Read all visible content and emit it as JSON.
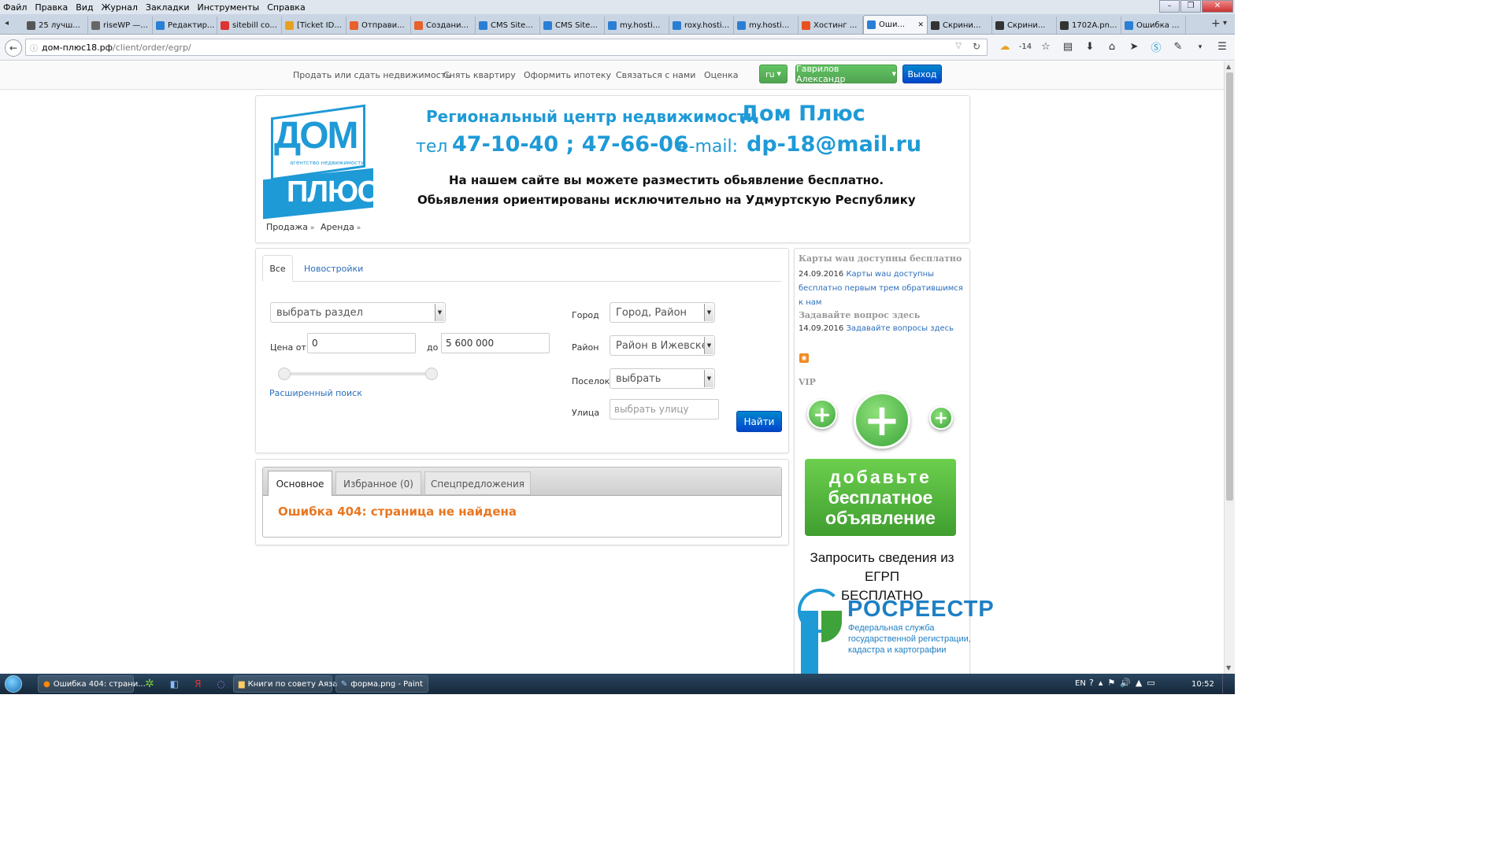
{
  "browser": {
    "menu": [
      "Файл",
      "Правка",
      "Вид",
      "Журнал",
      "Закладки",
      "Инструменты",
      "Справка"
    ],
    "tabs": [
      {
        "label": "25 лучш...",
        "color": "#555"
      },
      {
        "label": "riseWP —...",
        "color": "#666"
      },
      {
        "label": "Редактир...",
        "color": "#2a7fd4"
      },
      {
        "label": "sitebill co...",
        "color": "#d33"
      },
      {
        "label": "[Ticket ID...",
        "color": "#e8a020"
      },
      {
        "label": "Отправи...",
        "color": "#e8602c"
      },
      {
        "label": "Создани...",
        "color": "#e8602c"
      },
      {
        "label": "CMS Site...",
        "color": "#2a7fd4"
      },
      {
        "label": "CMS Site...",
        "color": "#2a7fd4"
      },
      {
        "label": "my.hosti...",
        "color": "#2a7fd4"
      },
      {
        "label": "roxy.hosti...",
        "color": "#2a7fd4"
      },
      {
        "label": "my.hosti...",
        "color": "#2a7fd4"
      },
      {
        "label": "Хостинг ...",
        "color": "#e85020"
      },
      {
        "label": "Оши...",
        "color": "#2a7fd4",
        "active": true
      },
      {
        "label": "Скрини...",
        "color": "#333"
      },
      {
        "label": "Скрини...",
        "color": "#333"
      },
      {
        "label": "1702A.pn...",
        "color": "#333"
      },
      {
        "label": "Ошибка ...",
        "color": "#2a7fd4"
      }
    ],
    "url_host": "дом-плюс18.рф",
    "url_path": "/client/order/egrp/",
    "weather": "-14"
  },
  "sitenav": {
    "links": [
      "Продать или сдать недвижимость",
      "Снять квартиру",
      "Оформить ипотеку",
      "Связаться с нами",
      "Оценка"
    ],
    "lang": "ru",
    "user": "Гаврилов Александр",
    "logout": "Выход"
  },
  "banner": {
    "logo_top": "ДОМ",
    "logo_sub": "агентство недвижимости",
    "logo_bottom": "ПЛЮС",
    "line1a": "Региональный центр недвижимости",
    "line1b": "Дом Плюс",
    "line2a": "тел",
    "line2b": "47-10-40 ; 47-66-06",
    "line2c": "e-mail:",
    "line2d": "dp-18@mail.ru",
    "line3": "На нашем сайте вы можете разместить обьявление бесплатно.",
    "line4": "Обьявления ориентированы  исключительно на Удмуртскую Республику",
    "menu": [
      "Продажа",
      "Аренда"
    ]
  },
  "search": {
    "tabs": [
      "Все",
      "Новостройки"
    ],
    "section_select": "выбрать раздел",
    "price_from_label": "Цена от",
    "price_from": "0",
    "price_to_label": "до",
    "price_to": "5 600 000",
    "advanced": "Расширенный поиск",
    "city_label": "Город",
    "city": "Город, Район",
    "district_label": "Район",
    "district": "Район в Ижевске",
    "village_label": "Поселок",
    "village": "выбрать",
    "street_label": "Улица",
    "street_placeholder": "выбрать улицу",
    "find": "Найти"
  },
  "results": {
    "tabs": [
      "Основное",
      "Избранное (0)",
      "Спецпредложения"
    ],
    "error": "Ошибка 404: страница не найдена"
  },
  "sidebar": {
    "news": [
      {
        "title": "Карты wau доступны бесплатно",
        "date": "24.09.2016",
        "text": "Карты wau доступны бесплатно первым трем обратившимся к нам"
      },
      {
        "title": "Задавайте вопрос здесь",
        "date": "14.09.2016",
        "text": "Задавайте вопросы здесь"
      }
    ],
    "vip": "VIP",
    "add_ad": [
      "добавьте",
      "бесплатное",
      "объявление"
    ],
    "egrp": [
      "Запросить сведения из ЕГРП",
      "БЕСПЛАТНО"
    ],
    "rosreestr": "РОСРЕЕСТР",
    "rosreestr_sub": [
      "Федеральная служба",
      "государственной регистрации,",
      "кадастра и картографии"
    ]
  },
  "taskbar": {
    "items": [
      "Ошибка 404: страни...",
      "Книги по совету Аяза",
      "форма.png - Paint"
    ],
    "lang": "EN",
    "time": "10:52"
  },
  "colors": {
    "brand_blue": "#1e9ad6",
    "error_orange": "#e87722",
    "green": "#51a351"
  }
}
